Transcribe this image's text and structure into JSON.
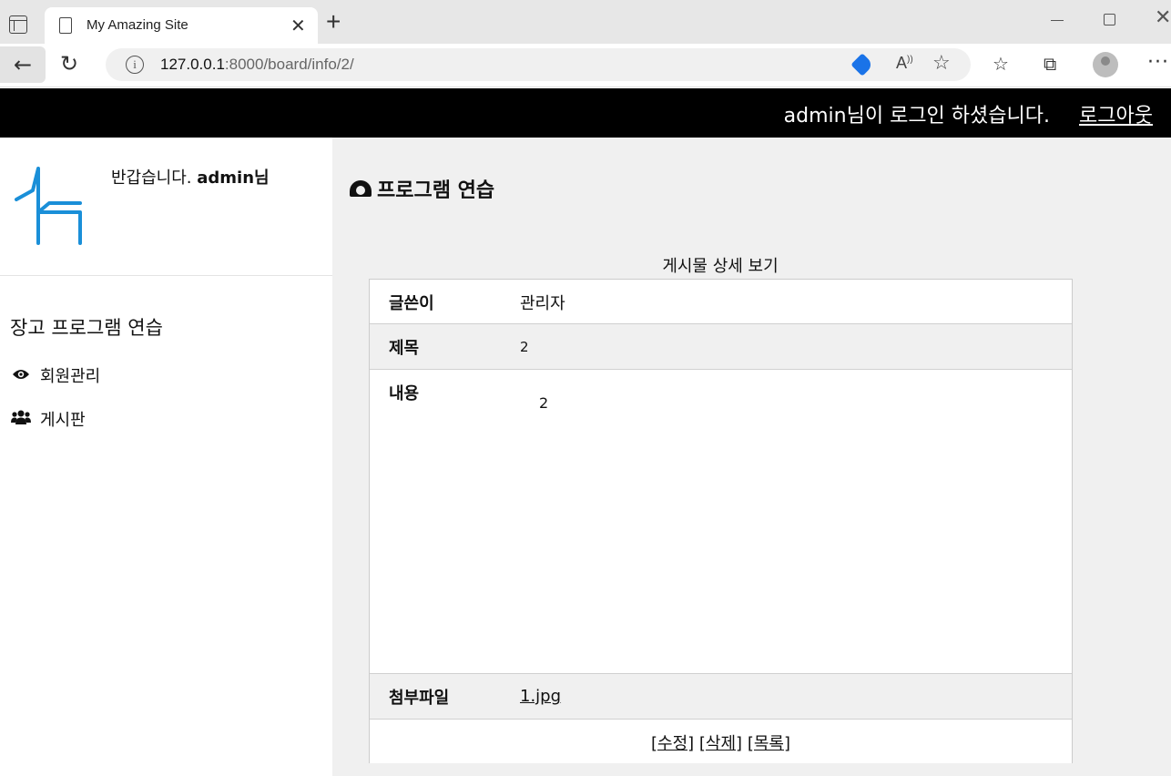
{
  "browser": {
    "tab_title": "My Amazing Site",
    "url_host": "127.0.0.1",
    "url_path": ":8000/board/info/2/"
  },
  "header": {
    "login_message": "admin님이 로그인 하셨습니다.",
    "logout_label": "로그아웃"
  },
  "sidebar": {
    "greeting_prefix": "반갑습니다.",
    "greeting_user": "admin님",
    "section_title": "장고 프로그램 연습",
    "items": [
      {
        "label": "회원관리",
        "icon": "eye-icon"
      },
      {
        "label": "게시판",
        "icon": "users-icon"
      }
    ],
    "logo_color": "#1a8fd8"
  },
  "main": {
    "title": "프로그램 연습",
    "caption": "게시물 상세 보기",
    "rows": [
      {
        "label": "글쓴이",
        "value": "관리자"
      },
      {
        "label": "제목",
        "value": "2"
      },
      {
        "label": "내용",
        "value": "2"
      },
      {
        "label": "첨부파일",
        "value": "1.jpg"
      }
    ],
    "actions": [
      "[수정]",
      "[삭제]",
      "[목록]"
    ]
  }
}
